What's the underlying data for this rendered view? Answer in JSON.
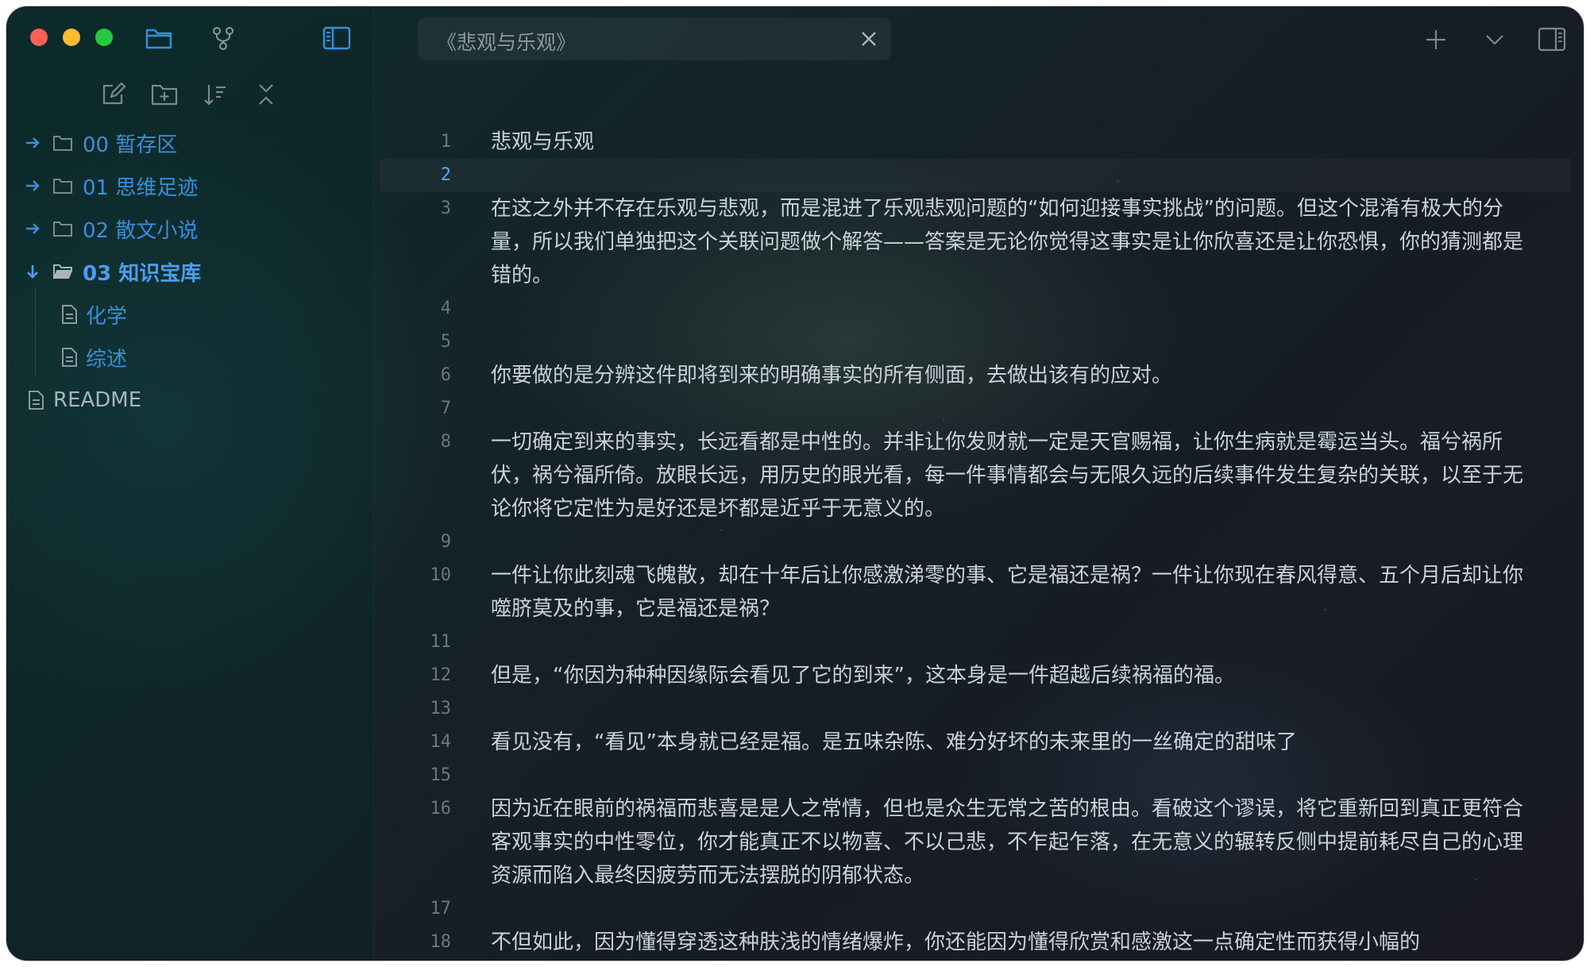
{
  "tab": {
    "title": "《悲观与乐观》"
  },
  "sidebar": {
    "tree": [
      {
        "label": "00 暂存区",
        "kind": "folder",
        "expanded": false
      },
      {
        "label": "01 思维足迹",
        "kind": "folder",
        "expanded": false
      },
      {
        "label": "02 散文小说",
        "kind": "folder",
        "expanded": false
      },
      {
        "label": "03 知识宝库",
        "kind": "folder",
        "expanded": true
      },
      {
        "label": "化学",
        "kind": "file",
        "parent": "03 知识宝库"
      },
      {
        "label": "综述",
        "kind": "file",
        "parent": "03 知识宝库"
      },
      {
        "label": "README",
        "kind": "file"
      }
    ]
  },
  "editor": {
    "active_line": 2,
    "lines": [
      {
        "n": "1",
        "text": "悲观与乐观"
      },
      {
        "n": "2",
        "text": ""
      },
      {
        "n": "3",
        "text": "在这之外并不存在乐观与悲观，而是混进了乐观悲观问题的“如何迎接事实挑战”的问题。但这个混淆有极大的分量，所以我们单独把这个关联问题做个解答——答案是无论你觉得这事实是让你欣喜还是让你恐惧，你的猜测都是错的。"
      },
      {
        "n": "4",
        "text": ""
      },
      {
        "n": "5",
        "text": ""
      },
      {
        "n": "6",
        "text": "你要做的是分辨这件即将到来的明确事实的所有侧面，去做出该有的应对。"
      },
      {
        "n": "7",
        "text": ""
      },
      {
        "n": "8",
        "text": "一切确定到来的事实，长远看都是中性的。并非让你发财就一定是天官赐福，让你生病就是霉运当头。福兮祸所伏，祸兮福所倚。放眼长远，用历史的眼光看，每一件事情都会与无限久远的后续事件发生复杂的关联，以至于无论你将它定性为是好还是坏都是近乎于无意义的。"
      },
      {
        "n": "9",
        "text": ""
      },
      {
        "n": "10",
        "text": "一件让你此刻魂飞魄散，却在十年后让你感激涕零的事、它是福还是祸？一件让你现在春风得意、五个月后却让你噬脐莫及的事，它是福还是祸？"
      },
      {
        "n": "11",
        "text": ""
      },
      {
        "n": "12",
        "text": "但是，“你因为种种因缘际会看见了它的到来”，这本身是一件超越后续祸福的福。"
      },
      {
        "n": "13",
        "text": ""
      },
      {
        "n": "14",
        "text": "看见没有，“看见”本身就已经是福。是五味杂陈、难分好坏的未来里的一丝确定的甜味了"
      },
      {
        "n": "15",
        "text": ""
      },
      {
        "n": "16",
        "text": "因为近在眼前的祸福而悲喜是是人之常情，但也是众生无常之苦的根由。看破这个谬误，将它重新回到真正更符合客观事实的中性零位，你才能真正不以物喜、不以己悲，不乍起乍落，在无意义的辗转反侧中提前耗尽自己的心理资源而陷入最终因疲劳而无法摆脱的阴郁状态。"
      },
      {
        "n": "17",
        "text": ""
      },
      {
        "n": "18",
        "text": "不但如此，因为懂得穿透这种肤浅的情绪爆炸，你还能因为懂得欣赏和感激这一点确定性而获得小幅的"
      }
    ]
  },
  "colors": {
    "accent": "#3a8edb",
    "line_number": "#6c7680",
    "active_line_number": "#5aa4ff",
    "text": "#c9d1d9"
  }
}
